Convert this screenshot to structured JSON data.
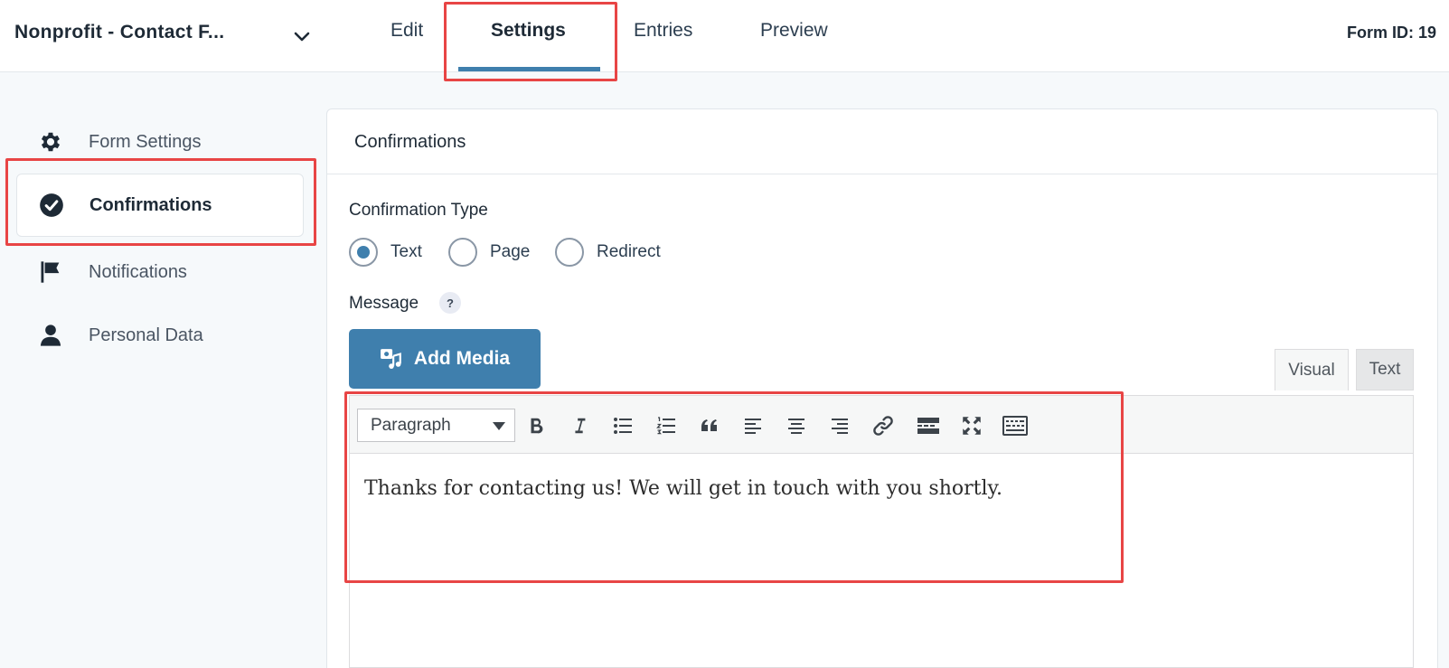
{
  "header": {
    "form_name": "Nonprofit - Contact F...",
    "tabs": [
      {
        "label": "Edit"
      },
      {
        "label": "Settings"
      },
      {
        "label": "Entries"
      },
      {
        "label": "Preview"
      }
    ],
    "form_id": "Form ID: 19",
    "active_tab": "Settings"
  },
  "sidebar": {
    "items": [
      {
        "label": "Form Settings",
        "icon": "gear-icon"
      },
      {
        "label": "Confirmations",
        "icon": "check-circle-icon",
        "active": true
      },
      {
        "label": "Notifications",
        "icon": "flag-icon"
      },
      {
        "label": "Personal Data",
        "icon": "user-icon"
      }
    ]
  },
  "panel": {
    "title": "Confirmations",
    "confirmation_type_label": "Confirmation Type",
    "radio_options": [
      {
        "label": "Text",
        "checked": true
      },
      {
        "label": "Page",
        "checked": false
      },
      {
        "label": "Redirect",
        "checked": false
      }
    ],
    "message_label": "Message",
    "help_glyph": "?",
    "add_media_label": "Add Media",
    "mode_tabs": {
      "visual": "Visual",
      "text": "Text"
    },
    "editor": {
      "format_select": "Paragraph",
      "content": "Thanks for contacting us! We will get in touch with you shortly."
    }
  },
  "colors": {
    "accent": "#3f7fad",
    "highlight": "#e84545"
  }
}
